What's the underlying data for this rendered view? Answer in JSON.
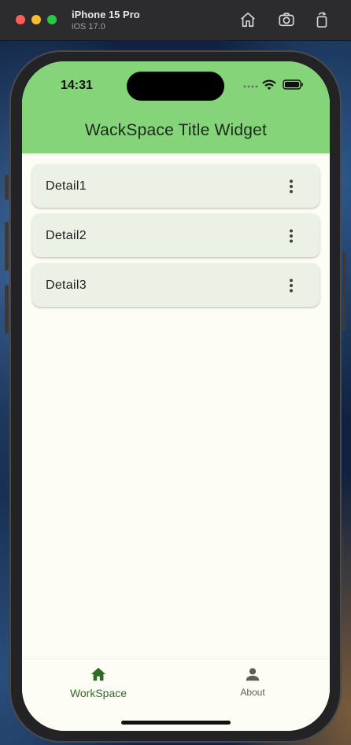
{
  "simulator": {
    "device_name": "iPhone 15 Pro",
    "os_version": "iOS 17.0",
    "toolbar_icons": [
      "home-icon",
      "screenshot-icon",
      "rotate-icon"
    ]
  },
  "status_bar": {
    "time": "14:31"
  },
  "app_bar": {
    "title": "WackSpace Title Widget",
    "color": "#86d47a"
  },
  "list": {
    "items": [
      {
        "label": "Detail1",
        "menu_icon": "more-vert-icon"
      },
      {
        "label": "Detail2",
        "menu_icon": "more-vert-icon"
      },
      {
        "label": "Detail3",
        "menu_icon": "more-vert-icon"
      }
    ]
  },
  "bottom_nav": {
    "items": [
      {
        "label": "WorkSpace",
        "icon": "home-icon",
        "selected": true
      },
      {
        "label": "About",
        "icon": "person-icon",
        "selected": false
      }
    ],
    "selected_color": "#2f6b27"
  }
}
